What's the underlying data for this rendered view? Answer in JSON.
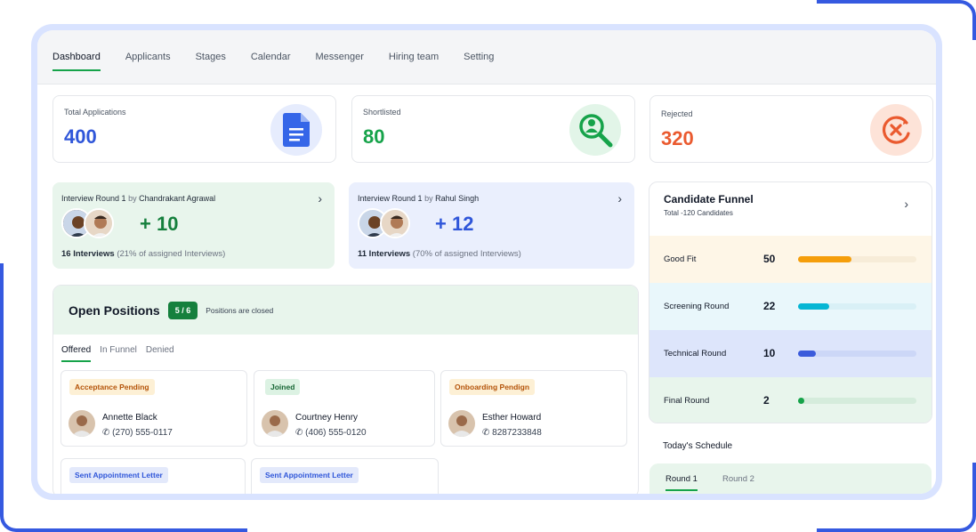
{
  "nav": {
    "tabs": [
      "Dashboard",
      "Applicants",
      "Stages",
      "Calendar",
      "Messenger",
      "Hiring team",
      "Setting"
    ],
    "active": "Dashboard"
  },
  "stats": [
    {
      "label": "Total Applications",
      "value": "400",
      "color": "#2f56d9",
      "icon": "document-icon"
    },
    {
      "label": "Shortlisted",
      "value": "80",
      "color": "#16a34a",
      "icon": "search-user-icon"
    },
    {
      "label": "Rejected",
      "value": "320",
      "color": "#ea5a2f",
      "icon": "reject-icon"
    }
  ],
  "interviews": [
    {
      "title": "Interview Round 1",
      "by": "by",
      "person": "Chandrakant Agrawal",
      "plus": "+ 10",
      "count": "16 Interviews",
      "note": "(21% of assigned Interviews)"
    },
    {
      "title": "Interview Round 1",
      "by": "by",
      "person": "Rahul Singh",
      "plus": "+ 12",
      "count": "11 Interviews",
      "note": "(70% of assigned Interviews)"
    }
  ],
  "open_positions": {
    "title": "Open Positions",
    "badge": "5 / 6",
    "note": "Positions are closed",
    "tabs": [
      "Offered",
      "In Funnel",
      "Denied"
    ],
    "active_tab": "Offered",
    "cards": [
      {
        "tag": "Acceptance Pending",
        "name": "Annette Black",
        "phone": "(270) 555-0117"
      },
      {
        "tag": "Joined",
        "name": "Courtney Henry",
        "phone": "(406) 555-0120"
      },
      {
        "tag": "Onboarding Pendign",
        "name": "Esther Howard",
        "phone": "8287233848"
      },
      {
        "tag": "Sent Appointment Letter"
      },
      {
        "tag": "Sent Appointment Letter"
      }
    ]
  },
  "funnel": {
    "title": "Candidate Funnel",
    "subtitle": "Total -120 Candidates",
    "rows": [
      {
        "label": "Good Fit",
        "value": "50",
        "fraction": 0.45,
        "color": "#f59e0b"
      },
      {
        "label": "Screening Round",
        "value": "22",
        "fraction": 0.26,
        "color": "#06b6d4"
      },
      {
        "label": "Technical Round",
        "value": "10",
        "fraction": 0.15,
        "color": "#3b5bdb"
      },
      {
        "label": "Final Round",
        "value": "2",
        "fraction": 0.05,
        "color": "#16a34a"
      }
    ]
  },
  "schedule": {
    "label": "Today's Schedule",
    "tabs": [
      "Round 1",
      "Round 2"
    ],
    "active_tab": "Round 1"
  }
}
